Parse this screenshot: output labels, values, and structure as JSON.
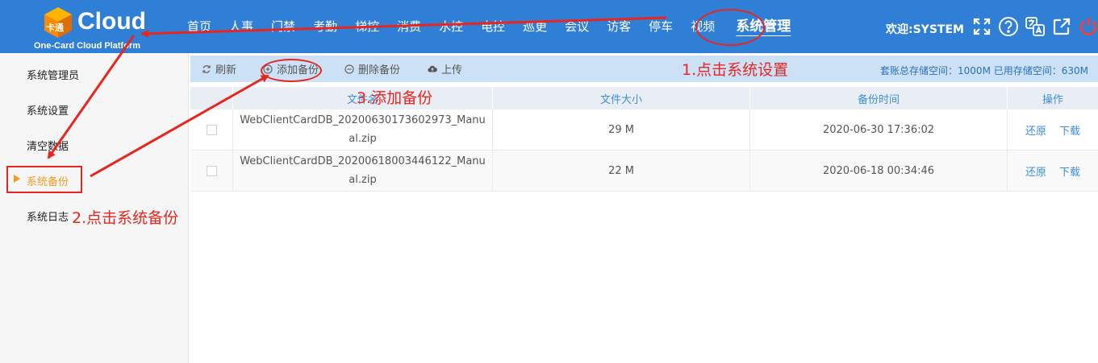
{
  "header": {
    "logo_text": "Cloud",
    "logo_mark_text": "卡通",
    "logo_sub": "One-Card Cloud Platform",
    "nav": [
      "首页",
      "人事",
      "门禁",
      "考勤",
      "梯控",
      "消费",
      "水控",
      "电控",
      "巡更",
      "会议",
      "访客",
      "停车",
      "视频"
    ],
    "active_nav": "系统管理",
    "welcome": "欢迎:SYSTEM",
    "icons": [
      "fullscreen-icon",
      "help-icon",
      "translate-icon",
      "external-link-icon",
      "power-icon"
    ]
  },
  "sidebar": {
    "items": [
      {
        "label": "系统管理员"
      },
      {
        "label": "系统设置"
      },
      {
        "label": "清空数据"
      },
      {
        "label": "系统备份"
      },
      {
        "label": "系统日志"
      }
    ]
  },
  "toolbar": {
    "refresh": "刷新",
    "add_backup": "添加备份",
    "delete_backup": "删除备份",
    "upload": "上传",
    "storage": "套账总存储空间：1000M 已用存储空间：630M"
  },
  "table": {
    "headers": [
      "文件名",
      "文件大小",
      "备份时间",
      "操作"
    ],
    "rows": [
      {
        "filename": "WebClientCardDB_20200630173602973_Manual.zip",
        "size": "29 M",
        "time": "2020-06-30 17:36:02",
        "restore": "还原",
        "download": "下载"
      },
      {
        "filename": "WebClientCardDB_20200618003446122_Manual.zip",
        "size": "22 M",
        "time": "2020-06-18 00:34:46",
        "restore": "还原",
        "download": "下载"
      }
    ]
  },
  "annotations": {
    "step1": "1.点击系统设置",
    "step2": "2.点击系统备份",
    "step3": "3.添加备份",
    "color": "#e8251f"
  },
  "colors": {
    "header_bg": "#2f7fd6",
    "toolbar_bg": "#cce1f6",
    "accent": "#3a8ee6",
    "active_sidebar": "#f59a23"
  }
}
